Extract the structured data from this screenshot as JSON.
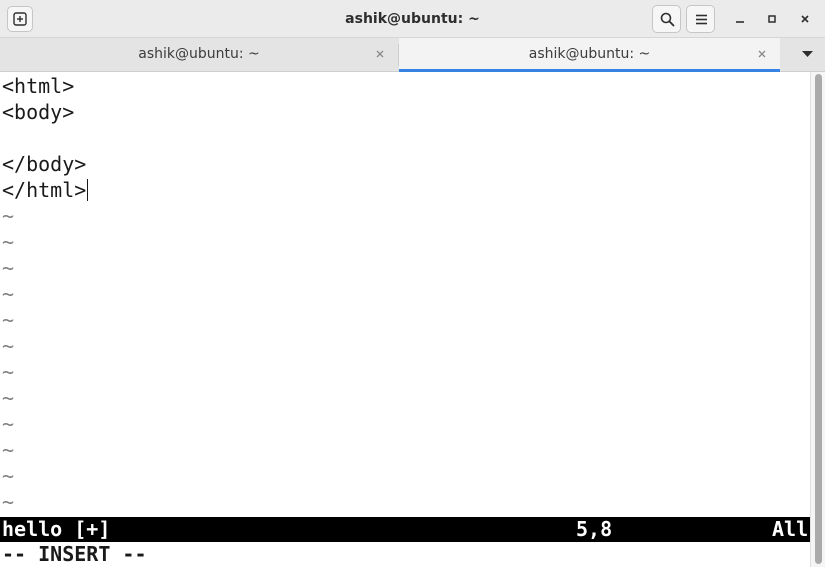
{
  "window": {
    "title": "ashik@ubuntu: ~"
  },
  "header_icons": {
    "new_tab": "new-tab-icon",
    "search": "search-icon",
    "menu": "hamburger-menu-icon",
    "minimize": "minimize-icon",
    "maximize": "maximize-icon",
    "close": "close-icon"
  },
  "tabs": [
    {
      "label": "ashik@ubuntu: ~",
      "active": false
    },
    {
      "label": "ashik@ubuntu: ~",
      "active": true
    }
  ],
  "editor": {
    "lines": [
      "<html>",
      "<body>",
      "",
      "</body>",
      "</html>"
    ],
    "empty_line_marker": "~",
    "empty_line_count": 12,
    "status": {
      "filename": "hello [+]",
      "position": "5,8",
      "scroll": "All"
    },
    "mode": "-- INSERT --"
  },
  "colors": {
    "accent": "#3584e4",
    "statusbar_bg": "#000000",
    "statusbar_fg": "#ffffff"
  }
}
